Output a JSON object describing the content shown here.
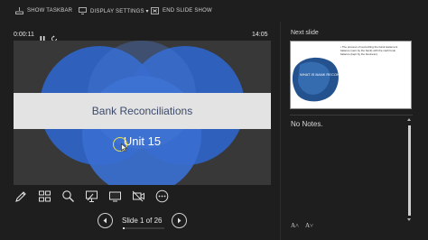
{
  "toolbar": {
    "show_taskbar": "SHOW TASKBAR",
    "display_settings": "DISPLAY SETTINGS ▾",
    "end_slide_show": "END SLIDE SHOW"
  },
  "presenter": {
    "elapsed_time": "0:00:11",
    "clock": "14:05"
  },
  "current_slide": {
    "title": "Bank Reconciliations",
    "subtitle": "Unit 15"
  },
  "tools": [
    {
      "icon": "pen-icon"
    },
    {
      "icon": "slides-grid-icon"
    },
    {
      "icon": "zoom-icon"
    },
    {
      "icon": "pointer-laser-icon"
    },
    {
      "icon": "black-screen-icon"
    },
    {
      "icon": "camera-off-icon"
    },
    {
      "icon": "more-options-icon"
    }
  ],
  "navigation": {
    "slide_counter": "Slide 1 of 26",
    "progress_fraction": 0.038
  },
  "next_slide": {
    "label": "Next slide",
    "bullet": "• The process of reconciling the bank statement balance (sent by the bank) with the cash book balance (kept by the business).",
    "title": "WHAT IS BANK RECONCILIATION?"
  },
  "notes": {
    "text": "No Notes."
  },
  "font_controls": {
    "increase": "A˄",
    "decrease": "A˅"
  },
  "colors": {
    "background": "#1e1e1e",
    "circle_blue": "#2f64c8",
    "title_band": "#e3e3e3",
    "title_text": "#3b4a6b",
    "cursor_ring": "#e7e24d"
  }
}
